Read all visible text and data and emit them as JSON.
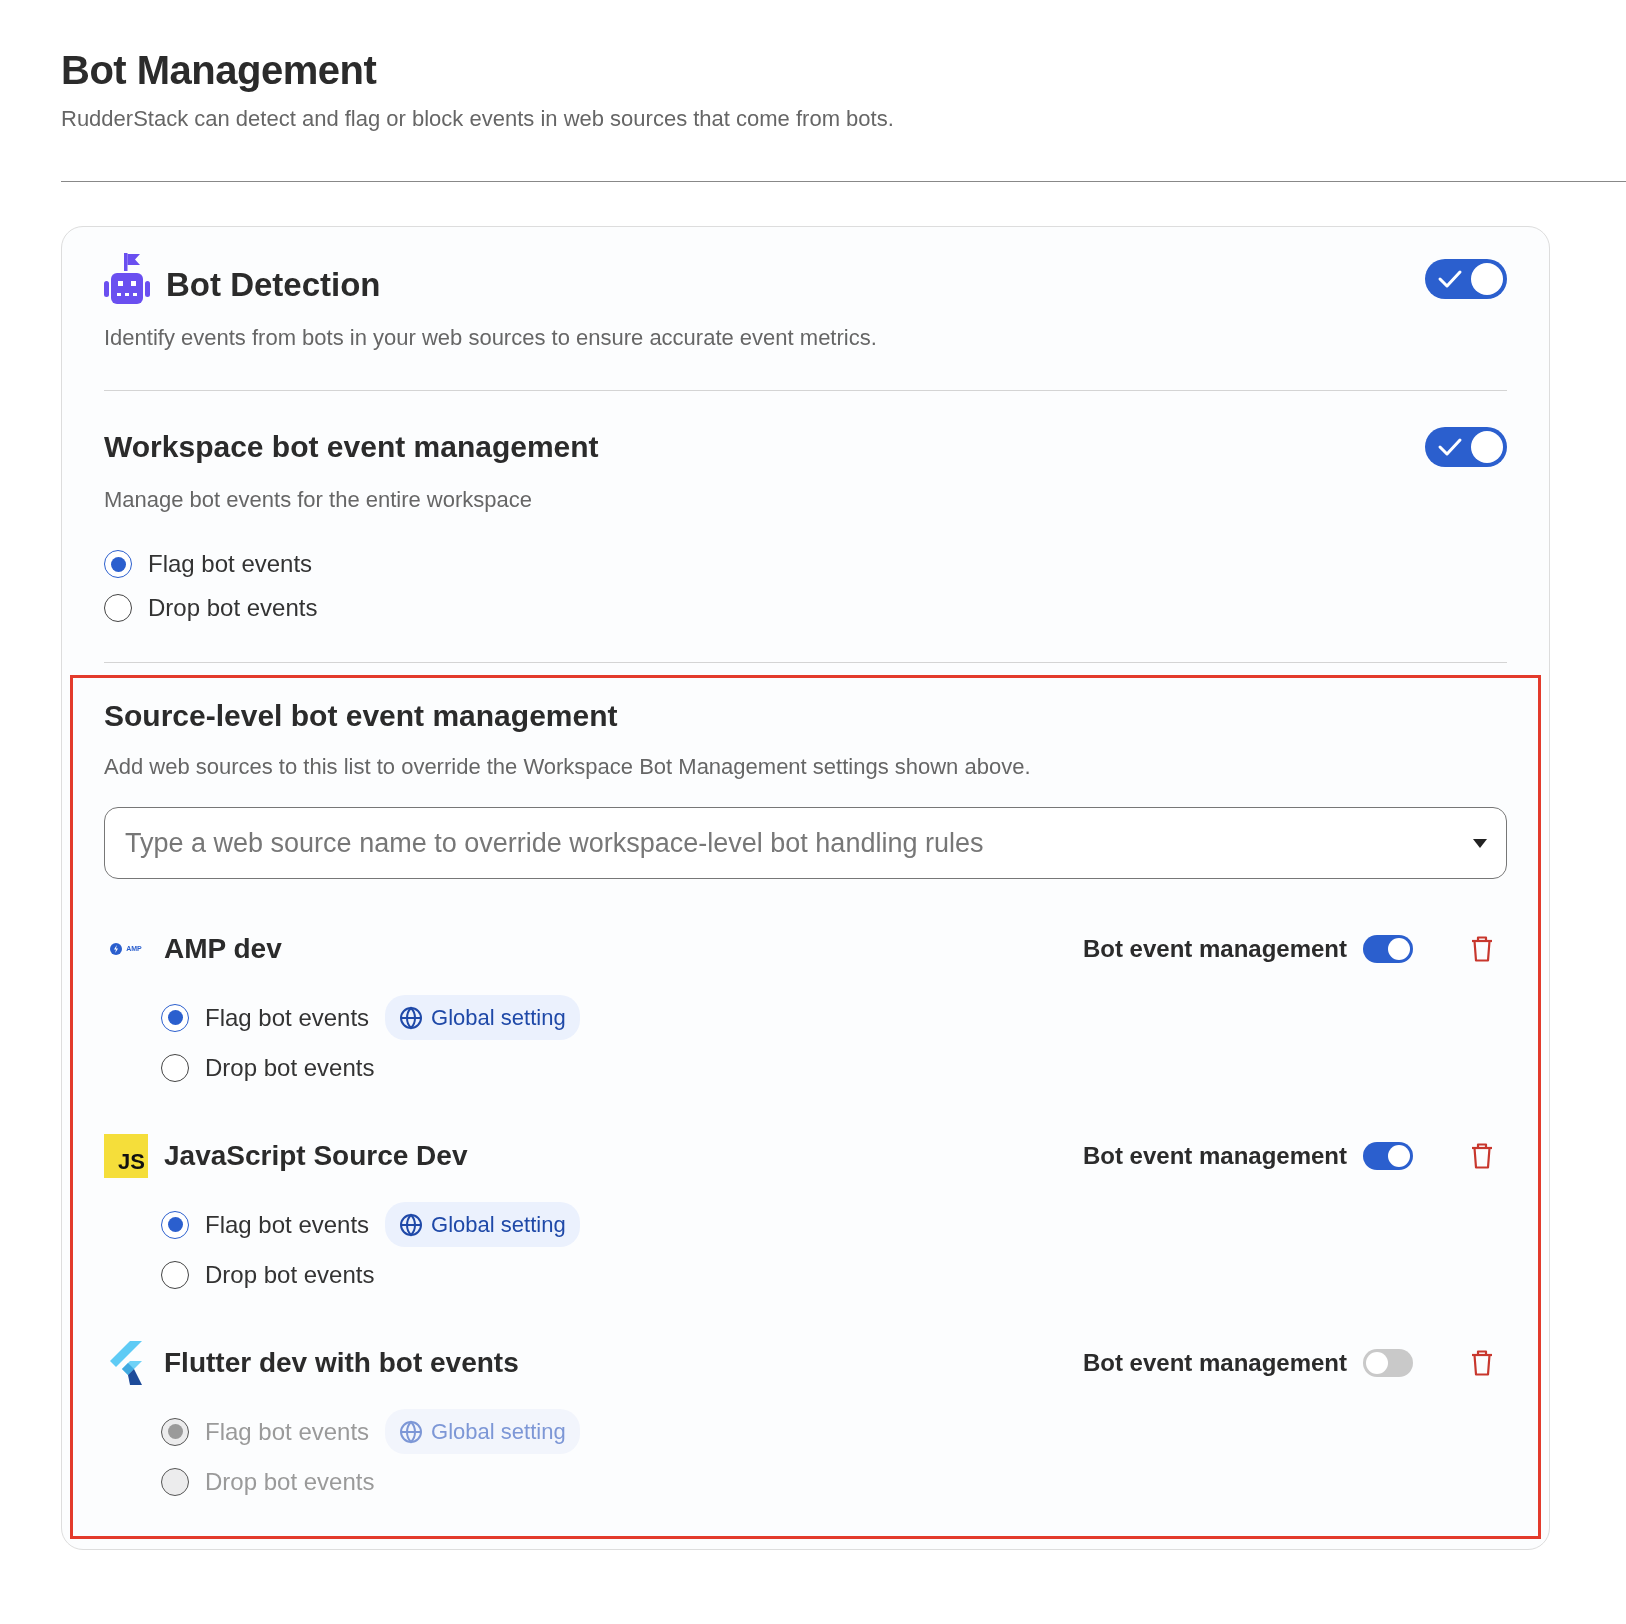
{
  "page": {
    "title": "Bot Management",
    "subtitle": "RudderStack can detect and flag or block events in web sources that come from bots."
  },
  "bot_detection": {
    "title": "Bot Detection",
    "description": "Identify events from bots in your web sources to ensure accurate event metrics.",
    "on": true
  },
  "workspace": {
    "title": "Workspace bot event management",
    "description": "Manage bot events for the entire workspace",
    "on": true,
    "options": [
      {
        "label": "Flag bot events",
        "selected": true
      },
      {
        "label": "Drop bot events",
        "selected": false
      }
    ]
  },
  "source_level": {
    "highlighted": true,
    "title": "Source-level bot event management",
    "description": "Add web sources to this list to override the Workspace Bot Management settings shown above.",
    "search": {
      "placeholder": "Type a web source name to override workspace-level bot handling rules"
    },
    "sources": [
      {
        "kind": "amp",
        "logo_text": "AMP",
        "name": "AMP dev",
        "toggle_label": "Bot event management",
        "on": true,
        "options": [
          {
            "label": "Flag bot events",
            "selected": true,
            "badge": "Global setting"
          },
          {
            "label": "Drop bot events",
            "selected": false
          }
        ]
      },
      {
        "kind": "js",
        "logo_text": "JS",
        "name": "JavaScript Source Dev",
        "toggle_label": "Bot event management",
        "on": true,
        "options": [
          {
            "label": "Flag bot events",
            "selected": true,
            "badge": "Global setting"
          },
          {
            "label": "Drop bot events",
            "selected": false
          }
        ]
      },
      {
        "kind": "flutter",
        "name": "Flutter dev with bot events",
        "toggle_label": "Bot event management",
        "on": false,
        "options": [
          {
            "label": "Flag bot events",
            "selected": true,
            "badge": "Global setting"
          },
          {
            "label": "Drop bot events",
            "selected": false
          }
        ]
      }
    ]
  }
}
